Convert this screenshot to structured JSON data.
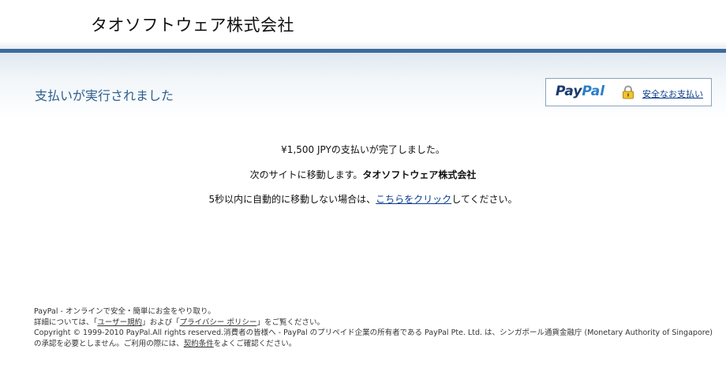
{
  "merchant": {
    "name": "タオソフトウェア株式会社"
  },
  "header": {
    "title": "支払いが実行されました"
  },
  "secure_box": {
    "logo_pay": "Pay",
    "logo_pal": "Pal",
    "link": "安全なお支払い"
  },
  "messages": {
    "completed": "¥1,500 JPYの支払いが完了しました。",
    "redirect_prefix": "次のサイトに移動します。",
    "redirect_merchant": "タオソフトウェア株式会社",
    "auto_prefix": "5秒以内に自動的に移動しない場合は、",
    "auto_link": "こちらをクリック",
    "auto_suffix": "してください。"
  },
  "footer": {
    "line1": "PayPal - オンラインで安全・簡単にお金をやり取り。",
    "line2_prefix": "詳細については、「",
    "user_agreement": "ユーザー規約",
    "line2_mid": "」および「",
    "privacy_policy": "プライバシー ポリシー",
    "line2_suffix": "」をご覧ください。",
    "line3_prefix": "Copyright © 1999-2010 PayPal.All rights reserved.消費者の皆様へ - PayPal のプリペイド企業の所有者である PayPal Pte. Ltd. は、シンガポール通貨金融庁 (Monetary Authority of Singapore) の承認を必要としません。ご利用の際には、",
    "terms_link": "契約条件",
    "line3_suffix": "をよくご確認ください。"
  },
  "colors": {
    "accent_bar": "#3c6b9c",
    "title": "#2d5f8d",
    "link": "#0a3c8c"
  },
  "icons": {
    "lock": "lock-icon"
  }
}
